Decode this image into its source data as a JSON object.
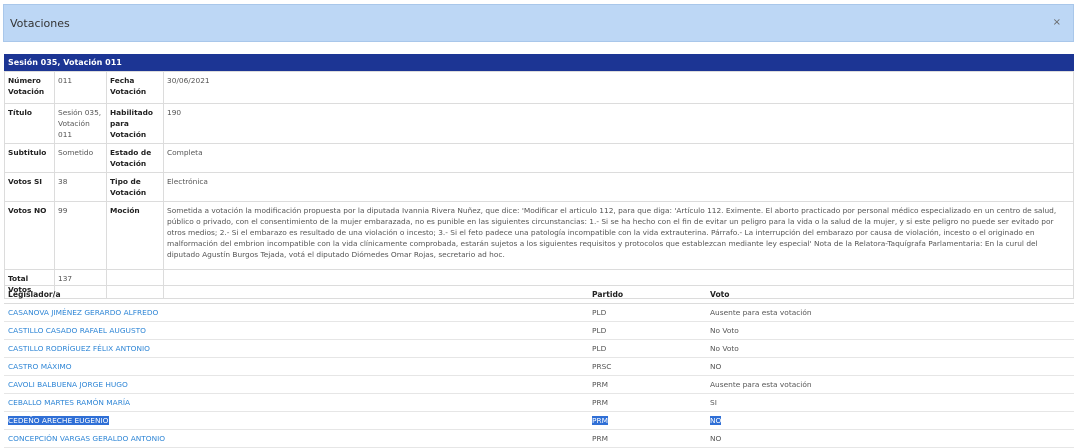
{
  "modal": {
    "title": "Votaciones",
    "close_label": "×"
  },
  "session": {
    "header": "Sesión 035, Votación 011"
  },
  "details": {
    "numero_label": "Número Votación",
    "numero_value": "011",
    "fecha_label": "Fecha Votación",
    "fecha_value": "30/06/2021",
    "titulo_label": "Título",
    "titulo_value": "Sesión 035, Votación 011",
    "habilitado_label": "Habilitado para Votación",
    "habilitado_value": "190",
    "subtitulo_label": "Subtitulo",
    "subtitulo_value": "Sometido",
    "estado_label": "Estado de Votación",
    "estado_value": "Completa",
    "si_label": "Votos SI",
    "si_value": "38",
    "tipo_label": "Tipo de Votación",
    "tipo_value": "Electrónica",
    "no_label": "Votos NO",
    "no_value": "99",
    "mocion_label": "Moción",
    "mocion_value": "Sometida a votación la modificación propuesta por la diputada Ivannia Rivera Nuñez, que dice: 'Modificar el articulo 112, para que diga: 'Artículo 112. Eximente. El aborto practicado por personal médico especializado en un centro de salud, público o privado, con el consentimiento de la mujer embarazada, no es punible en las siguientes circunstancias: 1.- Si se ha hecho con el fin de evitar un peligro para la vida o la salud de la mujer, y si este peligro no puede ser evitado por otros medios; 2.- Si el embarazo es resultado de una violación o incesto; 3.- Si el feto padece una patología incompatible con la vida extrauterina. Párrafo.- La interrupción del embarazo por causa de violación, incesto o el originado en malformación del embrion incompatible con la vida clínicamente comprobada, estarán sujetos a los siguientes requisitos y protocolos que establezcan mediante ley especial' Nota de la Relatora-Taquígrafa Parlamentaria: En la curul del diputado Agustín Burgos Tejada, votá el diputado Diómedes Omar Rojas, secretario ad hoc.",
    "total_label": "Total Votos",
    "total_value": "137"
  },
  "votes_table": {
    "headers": {
      "legislador": "Legislador/a",
      "partido": "Partido",
      "voto": "Voto"
    },
    "rows": [
      {
        "name": "CASANOVA JIMÉNEZ GERARDO ALFREDO",
        "party": "PLD",
        "vote": "Ausente para esta votación"
      },
      {
        "name": "CASTILLO CASADO RAFAEL AUGUSTO",
        "party": "PLD",
        "vote": "No Voto"
      },
      {
        "name": "CASTILLO RODRÍGUEZ FÉLIX ANTONIO",
        "party": "PLD",
        "vote": "No Voto"
      },
      {
        "name": "CASTRO MÁXIMO",
        "party": "PRSC",
        "vote": "NO"
      },
      {
        "name": "CAVOLI BALBUENA JORGE HUGO",
        "party": "PRM",
        "vote": "Ausente para esta votación"
      },
      {
        "name": "CEBALLO MARTES RAMÓN MARÍA",
        "party": "PRM",
        "vote": "SI"
      },
      {
        "name": "CEDEÑO ARECHE EUGENIO",
        "party": "PRM",
        "vote": "NO"
      },
      {
        "name": "CONCEPCIÓN VARGAS GERALDO ANTONIO",
        "party": "PRM",
        "vote": "NO"
      }
    ]
  }
}
